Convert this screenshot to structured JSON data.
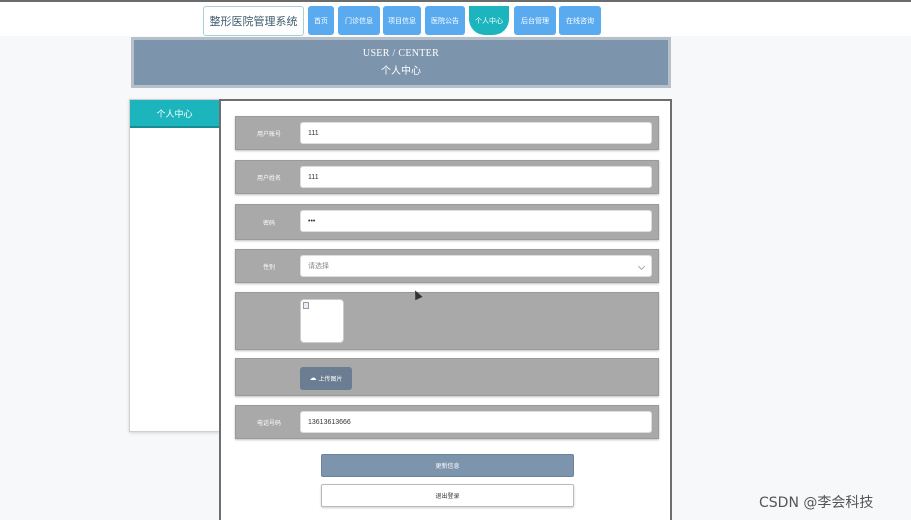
{
  "header": {
    "brand": "整形医院管理系统",
    "nav": [
      {
        "label": "首页",
        "active": false
      },
      {
        "label": "门诊信息",
        "active": false
      },
      {
        "label": "项目信息",
        "active": false
      },
      {
        "label": "医院公告",
        "active": false
      },
      {
        "label": "个人中心",
        "active": true
      },
      {
        "label": "后台管理",
        "active": false
      },
      {
        "label": "在线咨询",
        "active": false
      }
    ]
  },
  "banner": {
    "title_en": "USER / CENTER",
    "title_cn": "个人中心"
  },
  "sidebar": {
    "items": [
      {
        "label": "个人中心",
        "active": true
      }
    ]
  },
  "form": {
    "fields": [
      {
        "label": "用户账号",
        "value": "111"
      },
      {
        "label": "用户姓名",
        "value": "111"
      },
      {
        "label": "密码",
        "value": "•••"
      },
      {
        "label": "性别",
        "placeholder": "请选择"
      },
      {
        "label": "电话号码",
        "value": "13613613666"
      }
    ],
    "upload_label": "上传图片",
    "update_label": "更新信息",
    "logout_label": "退出登录"
  },
  "watermark": "CSDN @李会科技",
  "colors": {
    "accent": "#1cb5bd",
    "nav_blue": "#5aaaf0",
    "slate": "#7d94ad",
    "row_gray": "#a9a9a9"
  }
}
